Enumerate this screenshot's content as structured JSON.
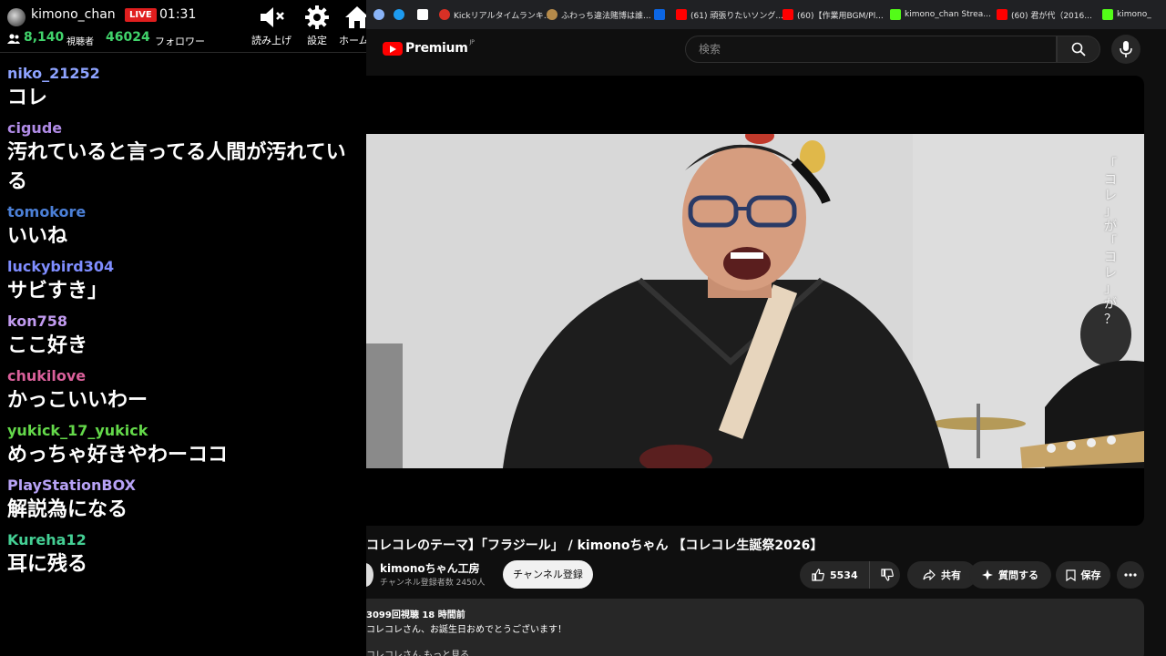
{
  "stream_header": {
    "channel_name": "kimono_chan",
    "live_label": "LIVE",
    "stream_time": "01:31",
    "viewer_count": "8,140",
    "viewer_label": "視聴者",
    "follower_count": "46024",
    "follower_label": "フォロワー",
    "buttons": [
      {
        "label": "読み上げ",
        "icon": "speaker-mute-icon"
      },
      {
        "label": "設定",
        "icon": "gear-icon"
      },
      {
        "label": "ホーム",
        "icon": "home-icon"
      }
    ]
  },
  "chat": {
    "messages": [
      {
        "user": "niko_21252",
        "color": "#8ea3ff",
        "text": "コレ"
      },
      {
        "user": "cigude",
        "color": "#b08be6",
        "text": "汚れていると言ってる人間が汚れている"
      },
      {
        "user": "tomokore",
        "color": "#4b7fd6",
        "text": "いいね"
      },
      {
        "user": "luckybird304",
        "color": "#7f8dff",
        "text": "サビすき」"
      },
      {
        "user": "kon758",
        "color": "#c29bf0",
        "text": "ここ好き"
      },
      {
        "user": "chukilove",
        "color": "#d9609a",
        "text": "かっこいいわー"
      },
      {
        "user": "yukick_17_yukick",
        "color": "#64d94a",
        "text": "めっちゃ好きやわーココ"
      },
      {
        "user": "PlayStationBOX",
        "color": "#b7a2f5",
        "text": "解説為になる"
      },
      {
        "user": "Kureha12",
        "color": "#44cf94",
        "text": "耳に残る"
      }
    ]
  },
  "bookmarks": [
    {
      "label": "",
      "icon": "globe-icon",
      "color": "#8ab4f8"
    },
    {
      "label": "",
      "icon": "bluesky-icon",
      "color": "#1d9bf0"
    },
    {
      "label": "",
      "icon": "x-icon",
      "color": "#ffffff"
    },
    {
      "label": "Kickリアルタイムランキ...",
      "icon": "kick-ranking-icon",
      "color": "#d93025"
    },
    {
      "label": "ふわっち違法賭博は誰...",
      "icon": "fuwacchi-icon",
      "color": "#b58a4a"
    },
    {
      "label": "",
      "icon": "trello-icon",
      "color": "#0c66e4"
    },
    {
      "label": "(61) 頑張りたいソング...",
      "icon": "youtube-icon",
      "color": "#ff0000"
    },
    {
      "label": "(60)【作業用BGM/Pl...",
      "icon": "youtube-icon",
      "color": "#ff0000"
    },
    {
      "label": "kimono_chan Strea...",
      "icon": "kick-icon",
      "color": "#53fc18"
    },
    {
      "label": "(60) 君が代（2016...",
      "icon": "youtube-icon",
      "color": "#ff0000"
    },
    {
      "label": "kimono_",
      "icon": "kick-icon",
      "color": "#53fc18"
    }
  ],
  "youtube": {
    "brand": "Premium",
    "region": "JP",
    "search_placeholder": "検索",
    "video": {
      "side_caption": [
        "「",
        "コ",
        "レ",
        "」",
        "が",
        "「",
        "コ",
        "レ",
        "」",
        "が",
        "？"
      ],
      "title": "コレコレのテーマ】「フラジール」 /  kimonoちゃん 【コレコレ生誕祭2026】",
      "channel": "kimonoちゃん工房",
      "subscribers": "チャンネル登録者数 2450人",
      "subscribe_label": "チャンネル登録",
      "like_count": "5534",
      "share_label": "共有",
      "ask_label": "質問する",
      "save_label": "保存",
      "views_meta": "3099回視聴  18 時間前",
      "description": "コレコレさん、お誕生日おめでとうございます！",
      "more_text": "コレコレさん   もっと見る"
    }
  }
}
